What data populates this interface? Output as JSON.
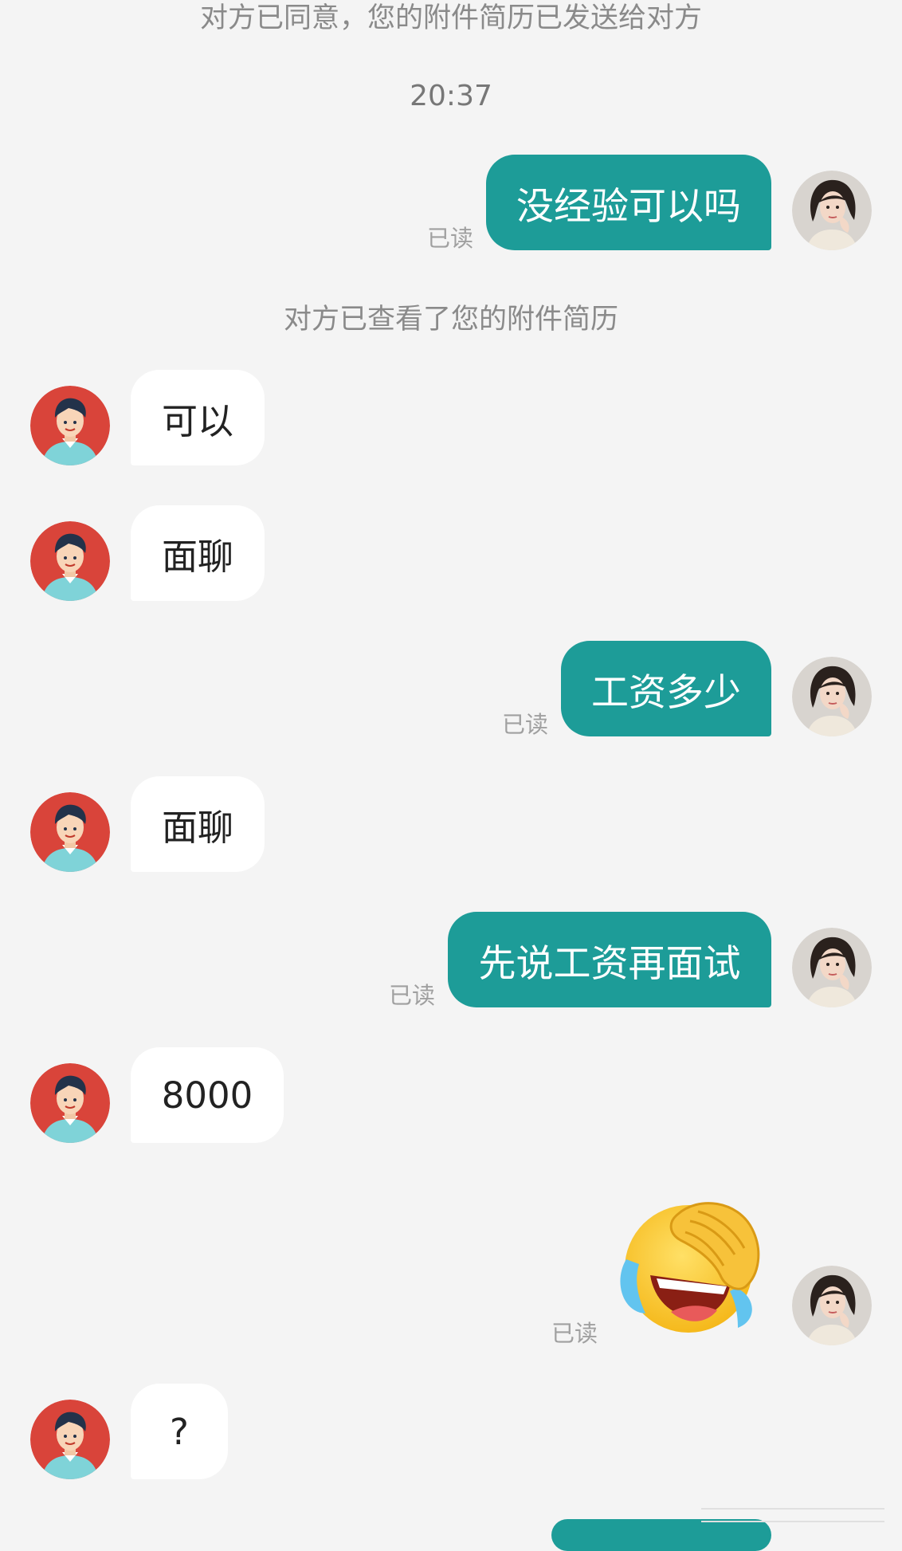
{
  "system": {
    "resume_sent": "对方已同意，您的附件简历已发送给对方",
    "time": "20:37",
    "resume_viewed": "对方已查看了您的附件简历"
  },
  "read_label": "已读",
  "messages": [
    {
      "from": "me",
      "text": "没经验可以吗"
    },
    {
      "from": "them",
      "text": "可以"
    },
    {
      "from": "them",
      "text": "面聊"
    },
    {
      "from": "me",
      "text": "工资多少"
    },
    {
      "from": "them",
      "text": "面聊"
    },
    {
      "from": "me",
      "text": "先说工资再面试"
    },
    {
      "from": "them",
      "text": "8000"
    },
    {
      "from": "me",
      "emoji": "facepalm-laugh-crying-emoji"
    },
    {
      "from": "them",
      "text": "?"
    }
  ],
  "colors": {
    "background": "#f4f4f4",
    "my_bubble": "#1d9c98",
    "their_bubble": "#ffffff",
    "recruiter_avatar": "#d9443a"
  }
}
